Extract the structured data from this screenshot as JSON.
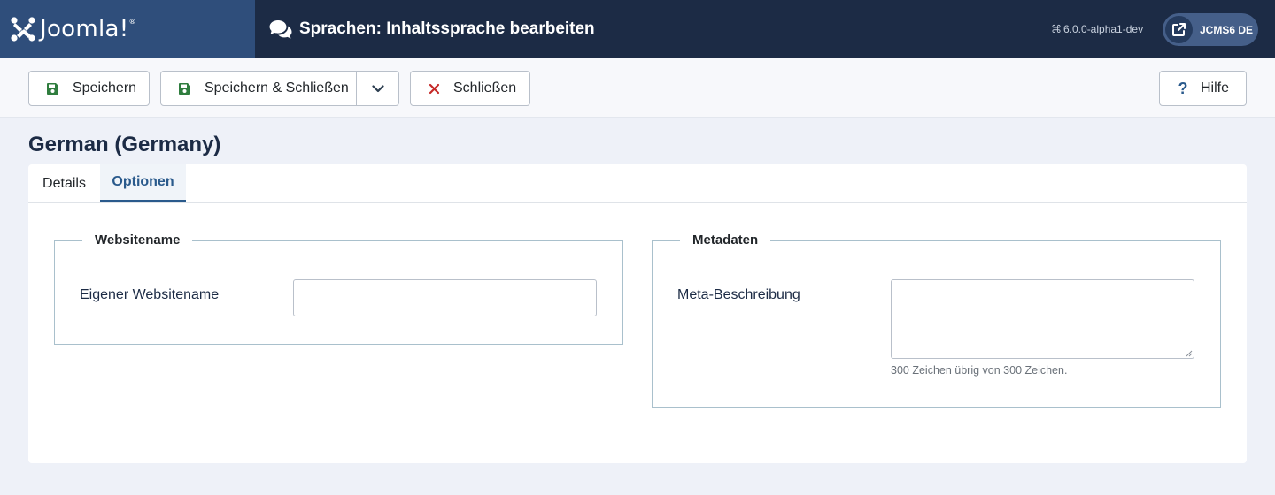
{
  "header": {
    "logo_text": "Joomla!",
    "page_title": "Sprachen: Inhaltssprache bearbeiten",
    "version": "6.0.0-alpha1-dev",
    "user_label": "JCMS6 DE",
    "icons": {
      "logo": "joomla-logo-icon",
      "title": "comments-icon",
      "version": "joomla-command-icon",
      "user": "external-link-icon"
    }
  },
  "toolbar": {
    "save_label": "Speichern",
    "save_close_label": "Speichern & Schließen",
    "close_label": "Schließen",
    "help_label": "Hilfe",
    "colors": {
      "save_icon": "#2f7d3e",
      "close_icon": "#c52827",
      "help_icon": "#2a5a8c"
    }
  },
  "record": {
    "title": "German (Germany)"
  },
  "tabs": [
    {
      "label": "Details",
      "active": false
    },
    {
      "label": "Optionen",
      "active": true
    }
  ],
  "fieldsets": {
    "site_name": {
      "legend": "Websitename",
      "label": "Eigener Websitename",
      "value": ""
    },
    "metadata": {
      "legend": "Metadaten",
      "label": "Meta-Beschreibung",
      "value": "",
      "char_counter": "300 Zeichen übrig von 300 Zeichen."
    }
  }
}
